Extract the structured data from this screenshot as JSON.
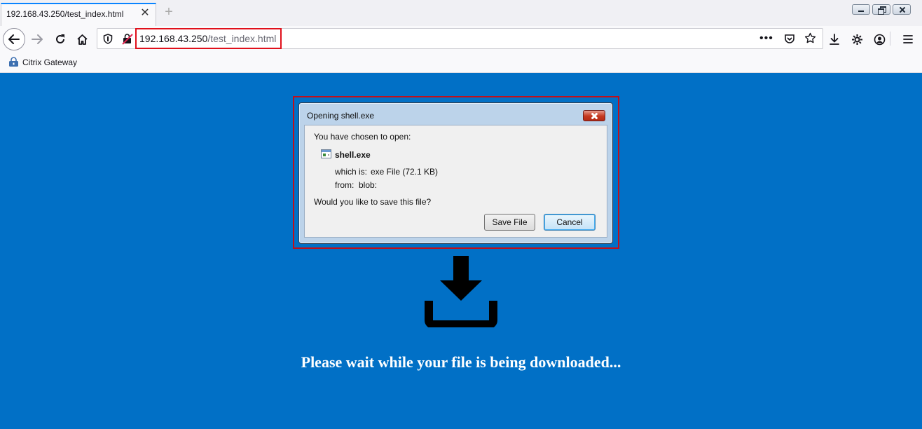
{
  "browser": {
    "tab": {
      "title": "192.168.43.250/test_index.html",
      "close_label": "✕"
    },
    "new_tab_label": "+",
    "url": {
      "host": "192.168.43.250",
      "path": "/test_index.html"
    },
    "bookmarks": [
      {
        "label": "Citrix Gateway",
        "icon": "lock-folder-icon"
      }
    ],
    "colors": {
      "highlight": "#e0101b",
      "accent": "#0a84ff"
    }
  },
  "dialog": {
    "title": "Opening shell.exe",
    "intro": "You have chosen to open:",
    "file_name": "shell.exe",
    "which_is_label": "which is:",
    "which_is_value": "exe File (72.1 KB)",
    "from_label": "from:",
    "from_value": "blob:",
    "question": "Would you like to save this file?",
    "save_label": "Save File",
    "cancel_label": "Cancel"
  },
  "page": {
    "background": "#0170c6",
    "message": "Please wait while your file is being downloaded..."
  }
}
